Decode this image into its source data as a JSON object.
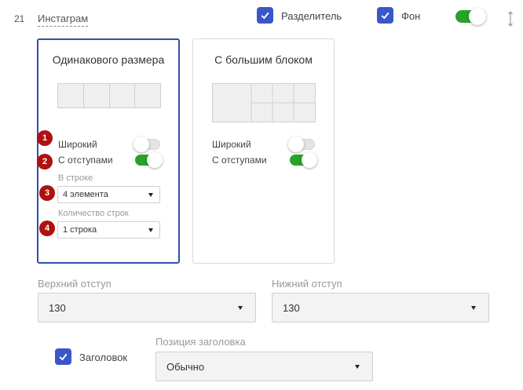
{
  "header": {
    "row_number": "21",
    "block_name": "Инстаграм",
    "divider_label": "Разделитель",
    "background_label": "Фон"
  },
  "cards": [
    {
      "title": "Одинакового размера",
      "wide_label": "Широкий",
      "padding_label": "С отступами",
      "per_row_label": "В строке",
      "per_row_value": "4 элемента",
      "rows_label": "Количество строк",
      "rows_value": "1 строка"
    },
    {
      "title": "С большим блоком",
      "wide_label": "Широкий",
      "padding_label": "С отступами"
    }
  ],
  "badges": [
    "1",
    "2",
    "3",
    "4"
  ],
  "top_margin": {
    "label": "Верхний отступ",
    "value": "130"
  },
  "bottom_margin": {
    "label": "Нижний отступ",
    "value": "130"
  },
  "heading": {
    "label": "Заголовок",
    "position_label": "Позиция заголовка",
    "position_value": "Обычно"
  },
  "colors": {
    "accent": "#3a57c9",
    "toggle_on": "#27a327",
    "selected_border": "#2f50a6",
    "badge": "#b01010"
  }
}
